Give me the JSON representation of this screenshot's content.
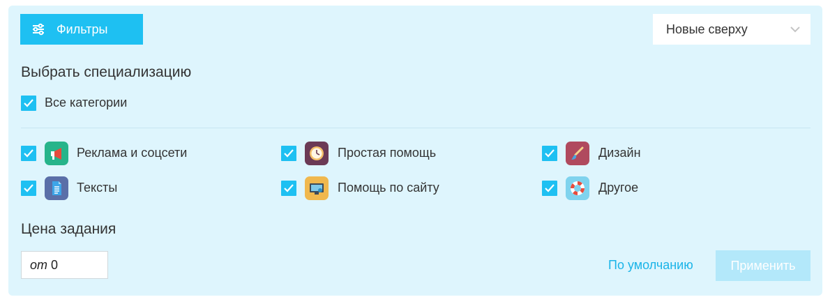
{
  "toolbar": {
    "filters_label": "Фильтры",
    "sort_value": "Новые сверху"
  },
  "specialization": {
    "title": "Выбрать специализацию",
    "all_label": "Все категории",
    "all_checked": true,
    "categories": [
      {
        "label": "Реклама и соцсети",
        "icon": "megaphone-icon",
        "color": "#27b48a",
        "checked": true
      },
      {
        "label": "Простая помощь",
        "icon": "clock-icon",
        "color": "#6b3a55",
        "checked": true
      },
      {
        "label": "Дизайн",
        "icon": "brush-icon",
        "color": "#b04a5e",
        "checked": true
      },
      {
        "label": "Тексты",
        "icon": "document-icon",
        "color": "#5a6fa8",
        "checked": true
      },
      {
        "label": "Помощь по сайту",
        "icon": "monitor-icon",
        "color": "#f0b84e",
        "checked": true
      },
      {
        "label": "Другое",
        "icon": "lifebuoy-icon",
        "color": "#7fd3ee",
        "checked": true
      }
    ]
  },
  "price": {
    "title": "Цена задания",
    "prefix": "от",
    "value": "0"
  },
  "actions": {
    "default_label": "По умолчанию",
    "apply_label": "Применить"
  },
  "colors": {
    "panel_bg": "#def5fd",
    "accent": "#1ec0f2",
    "apply_disabled": "#b3e8fa",
    "link": "#1ab4e8"
  }
}
